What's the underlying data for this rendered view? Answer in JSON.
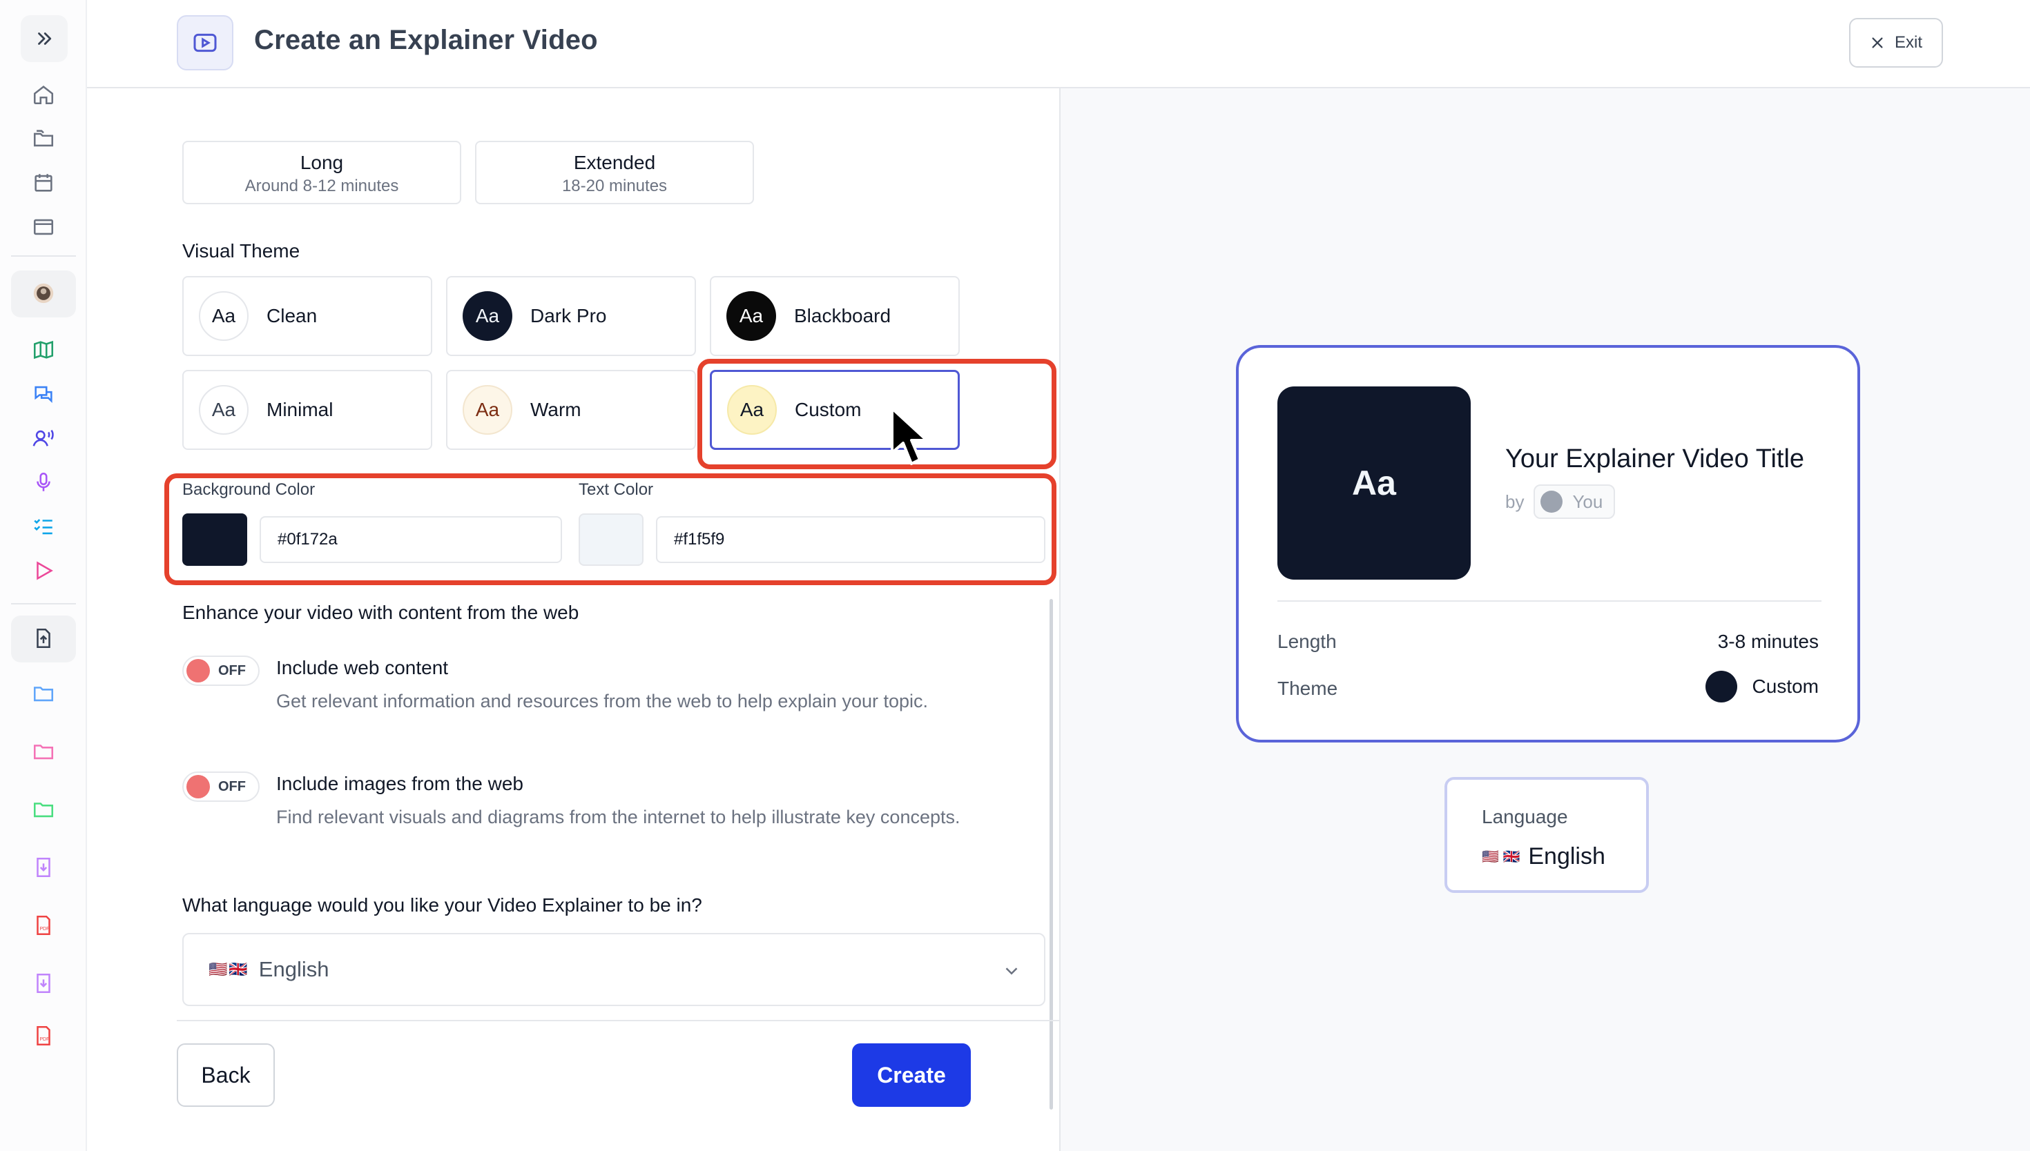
{
  "header": {
    "title": "Create an Explainer Video",
    "exit_label": "Exit"
  },
  "length_options": [
    {
      "title": "Long",
      "subtitle": "Around 8-12 minutes"
    },
    {
      "title": "Extended",
      "subtitle": "18-20 minutes"
    }
  ],
  "visual_theme": {
    "label": "Visual Theme",
    "themes": [
      {
        "name": "Clean",
        "swatch_text": "Aa",
        "bg": "#ffffff",
        "fg": "#111827",
        "border": "#e5e7eb"
      },
      {
        "name": "Dark Pro",
        "swatch_text": "Aa",
        "bg": "#0f172a",
        "fg": "#f1f5f9",
        "border": "#0f172a"
      },
      {
        "name": "Blackboard",
        "swatch_text": "Aa",
        "bg": "#0a0a0a",
        "fg": "#ffffff",
        "border": "#0a0a0a"
      },
      {
        "name": "Minimal",
        "swatch_text": "Aa",
        "bg": "#ffffff",
        "fg": "#374151",
        "border": "#e5e7eb"
      },
      {
        "name": "Warm",
        "swatch_text": "Aa",
        "bg": "#fdf6e8",
        "fg": "#7c2d12",
        "border": "#f3e6cf"
      },
      {
        "name": "Custom",
        "swatch_text": "Aa",
        "bg": "#fdf3c4",
        "fg": "#111827",
        "border": "#f6e9a8"
      }
    ],
    "selected": "Custom"
  },
  "custom_colors": {
    "background_label": "Background Color",
    "background_value": "#0f172a",
    "background_display": "#0f172a",
    "text_label": "Text Color",
    "text_value": "#f1f5f9",
    "text_display": "#f1f5f9"
  },
  "web_content": {
    "heading": "Enhance your video with content from the web",
    "options": [
      {
        "toggle": "OFF",
        "title": "Include web content",
        "description": "Get relevant information and resources from the web to help explain your topic."
      },
      {
        "toggle": "OFF",
        "title": "Include images from the web",
        "description": "Find relevant visuals and diagrams from the internet to help illustrate key concepts."
      }
    ]
  },
  "language": {
    "question": "What language would you like your Video Explainer to be in?",
    "flags": "🇺🇸🇬🇧",
    "selected": "English"
  },
  "footer": {
    "back_label": "Back",
    "create_label": "Create"
  },
  "preview": {
    "thumb_text": "Aa",
    "title": "Your Explainer Video Title",
    "by_label": "by",
    "author": "You",
    "length_label": "Length",
    "length_value": "3-8 minutes",
    "theme_label": "Theme",
    "theme_value": "Custom",
    "language_label": "Language",
    "language_flags": "🇺🇸 🇬🇧",
    "language_value": "English"
  },
  "colors": {
    "accent": "#1d3ae6",
    "highlight": "#e5412c",
    "selected_border": "#4f58d4",
    "toggle_off": "#ef7272"
  }
}
